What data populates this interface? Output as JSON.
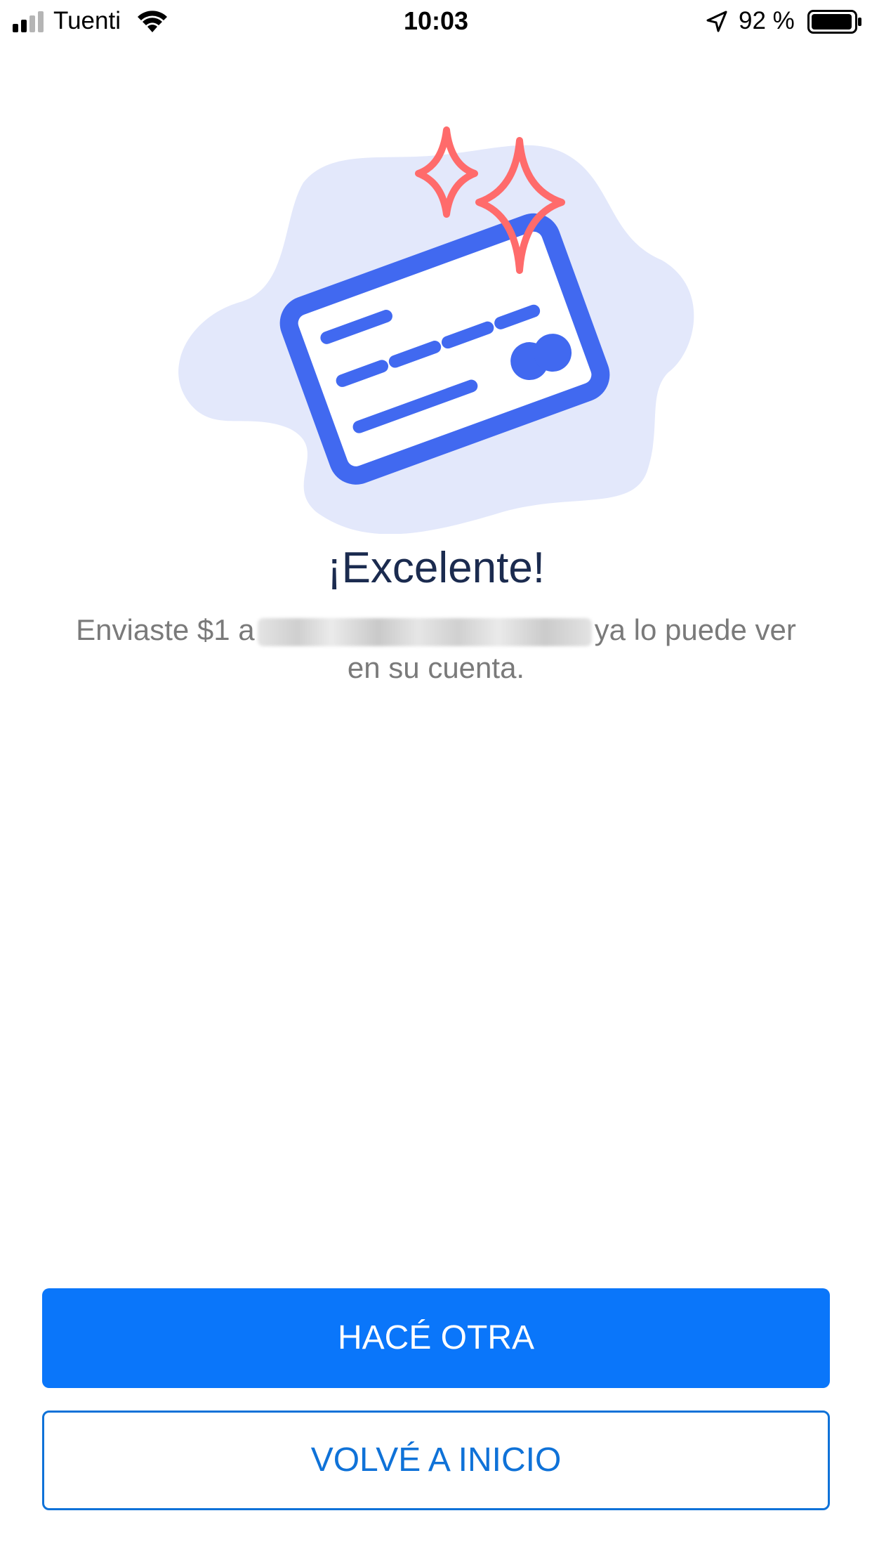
{
  "status_bar": {
    "carrier": "Tuenti",
    "time": "10:03",
    "battery_percent": "92 %",
    "icons": [
      "signal-icon",
      "wifi-icon",
      "location-arrow-icon",
      "battery-icon"
    ]
  },
  "illustration": {
    "icon": "credit-card-sparkles-icon",
    "colors": {
      "blob": "#e3e8fb",
      "card": "#4169f0",
      "sparkle": "#ff6b6b"
    }
  },
  "success": {
    "title": "¡Excelente!",
    "message_prefix": "Enviaste $1 a",
    "message_suffix": "ya lo puede ver en su cuenta."
  },
  "actions": {
    "primary_label": "HACÉ OTRA",
    "secondary_label": "VOLVÉ A INICIO",
    "colors": {
      "primary_bg": "#0a76fa",
      "secondary_border": "#0f72d8"
    }
  }
}
